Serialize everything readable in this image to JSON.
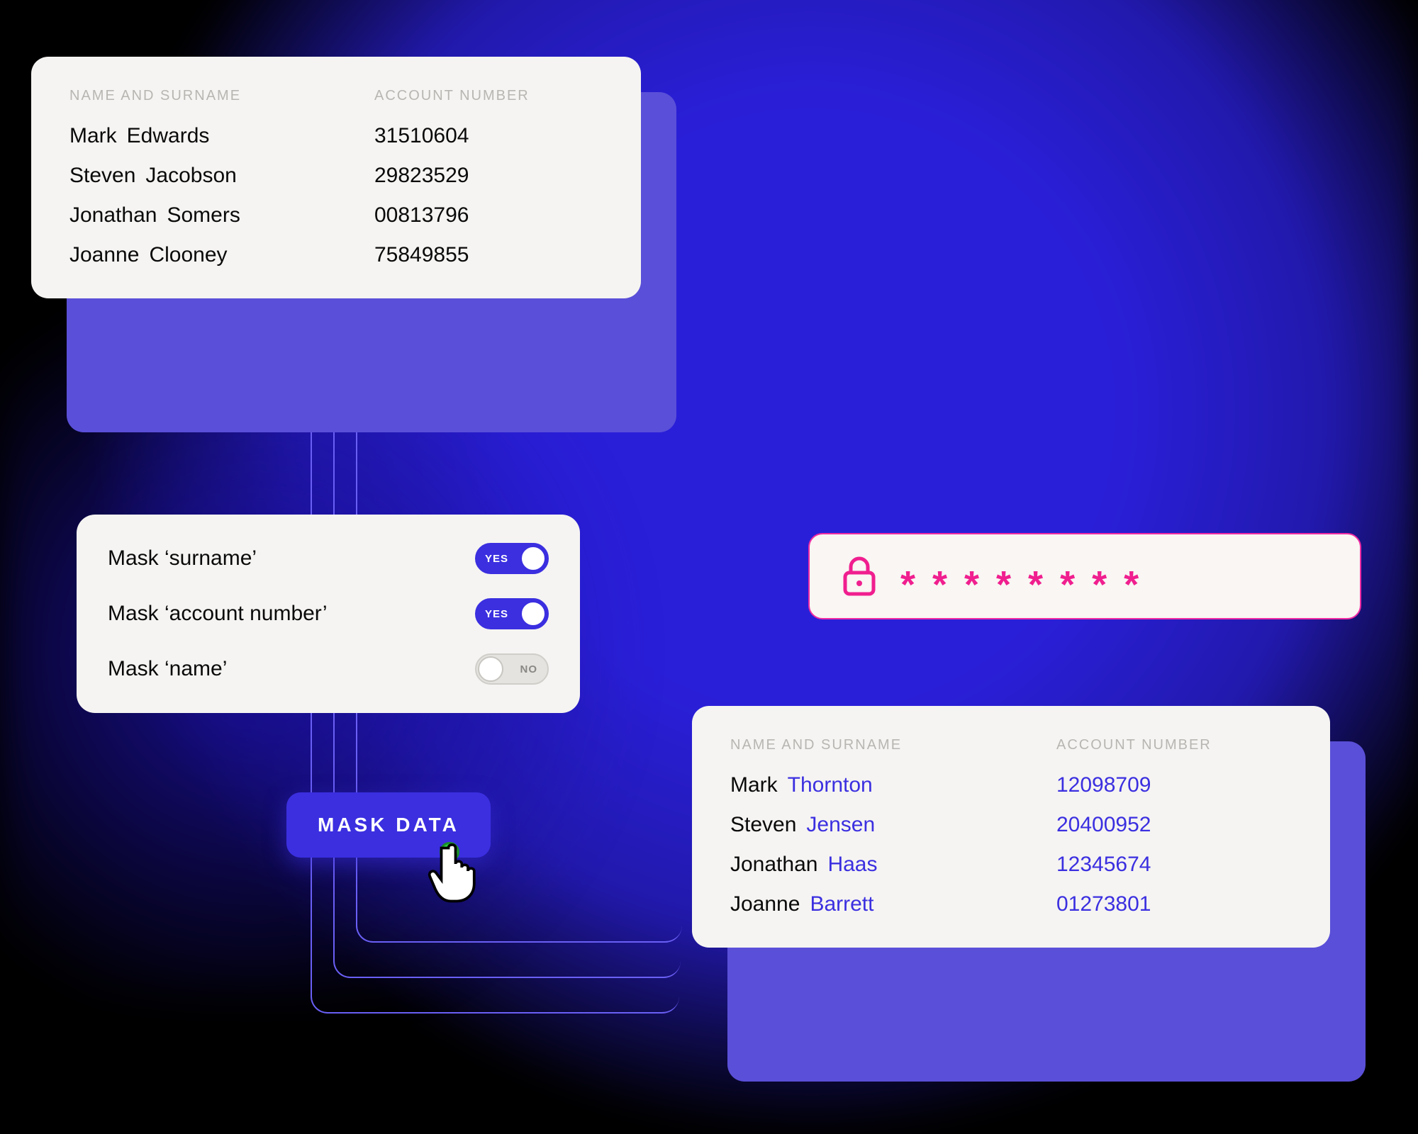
{
  "colors": {
    "accent": "#3b2fe0",
    "pink": "#f01f8f",
    "cardBg": "#f5f4f2"
  },
  "sourceTable": {
    "headers": {
      "name": "NAME AND SURNAME",
      "account": "ACCOUNT NUMBER"
    },
    "rows": [
      {
        "first": "Mark",
        "last": "Edwards",
        "acct": "31510604"
      },
      {
        "first": "Steven",
        "last": "Jacobson",
        "acct": "29823529"
      },
      {
        "first": "Jonathan",
        "last": "Somers",
        "acct": "00813796"
      },
      {
        "first": "Joanne",
        "last": "Clooney",
        "acct": "75849855"
      }
    ]
  },
  "settings": {
    "items": [
      {
        "label": "Mask ‘surname’",
        "state": "YES",
        "on": true
      },
      {
        "label": "Mask ‘account number’",
        "state": "YES",
        "on": true
      },
      {
        "label": "Mask ‘name’",
        "state": "NO",
        "on": false
      }
    ]
  },
  "action": {
    "button": "MASK DATA"
  },
  "password": {
    "mask": "********"
  },
  "resultTable": {
    "headers": {
      "name": "NAME AND SURNAME",
      "account": "ACCOUNT NUMBER"
    },
    "rows": [
      {
        "first": "Mark",
        "last": "Thornton",
        "acct": "12098709"
      },
      {
        "first": "Steven",
        "last": "Jensen",
        "acct": "20400952"
      },
      {
        "first": "Jonathan",
        "last": "Haas",
        "acct": "12345674"
      },
      {
        "first": "Joanne",
        "last": "Barrett",
        "acct": "01273801"
      }
    ]
  }
}
